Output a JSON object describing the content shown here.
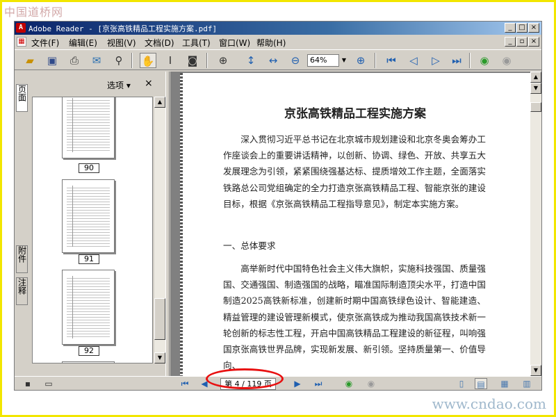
{
  "watermark": {
    "top": "中国道桥网",
    "bottom": "www.cndao.com"
  },
  "window": {
    "title": "Adobe Reader - [京张高铁精品工程实施方案.pdf]",
    "app_icon_glyph": "A",
    "controls": {
      "minimize": "_",
      "maximize": "□",
      "close": "×"
    }
  },
  "menu": {
    "items": [
      "文件(F)",
      "编辑(E)",
      "视图(V)",
      "文档(D)",
      "工具(T)",
      "窗口(W)",
      "帮助(H)"
    ],
    "doc_controls": {
      "minimize": "_",
      "restore": "▫",
      "close": "×"
    }
  },
  "toolbar": {
    "zoom_value": "64%",
    "icons": [
      "open-folder",
      "save",
      "print",
      "email",
      "search-binoculars",
      "hand-tool",
      "select-text",
      "snapshot",
      "zoom-in",
      "fit-page",
      "fit-width",
      "zoom-out",
      "zoom-in-plus",
      "first-page",
      "prev-page",
      "next-page",
      "last-page",
      "go-back",
      "go-forward"
    ]
  },
  "side_tabs": {
    "pages": "页面",
    "attachments": "附件",
    "comments": "注释"
  },
  "nav_pane": {
    "options_label": "选项",
    "close_glyph": "×",
    "thumbnails": [
      {
        "label": "90"
      },
      {
        "label": "91"
      },
      {
        "label": "92"
      }
    ]
  },
  "document": {
    "title": "京张高铁精品工程实施方案",
    "paragraph1": "深入贯彻习近平总书记在北京城市规划建设和北京冬奥会筹办工作座谈会上的重要讲话精神，以创新、协调、绿色、开放、共享五大发展理念为引领，紧紧围绕强基达标、提质增效工作主题，全面落实铁路总公司党组确定的全力打造京张高铁精品工程、智能京张的建设目标，根据《京张高铁精品工程指导意见》，制定本实施方案。",
    "section_heading": "一、总体要求",
    "paragraph2": "高举新时代中国特色社会主义伟大旗帜，实施科技强国、质量强国、交通强国、制造强国的战略，瞄准国际制造顶尖水平，打造中国制造2025高铁新标准，创建新时期中国高铁绿色设计、智能建造、精益管理的建设管理新模式，使京张高铁成为推动我国高铁技术新一轮创新的标志性工程，开启中国高铁精品工程建设的新征程，叫响强国京张高铁世界品牌，实现新发展、新引领。坚持质量第一、价值导向、"
  },
  "statusbar": {
    "page_indicator": "第 4 / 119 页"
  },
  "colors": {
    "frame": "#f2e600",
    "annotation_ellipse": "#e81010",
    "titlebar": "#0a246a",
    "chrome": "#d4d0c8"
  }
}
